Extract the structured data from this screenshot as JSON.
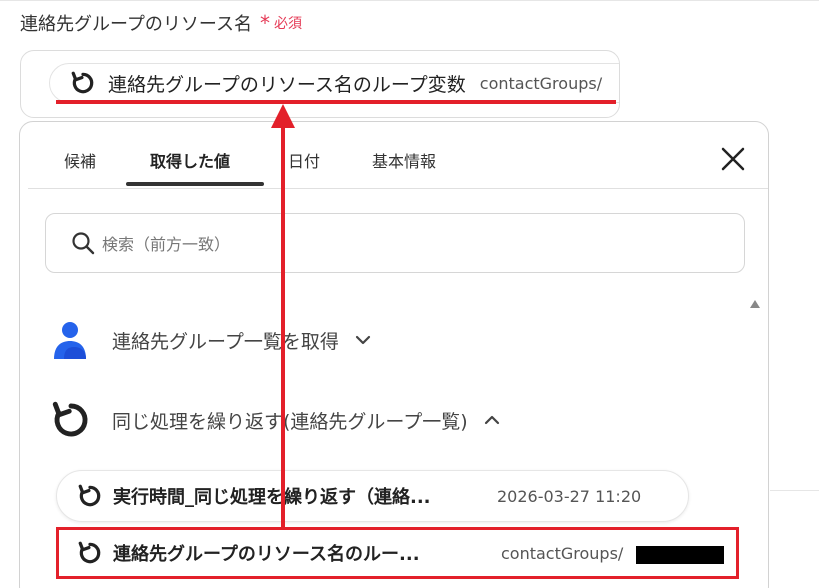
{
  "field": {
    "label": "連絡先グループのリソース名",
    "asterisk": "*",
    "required": "必須",
    "chip_title": "連絡先グループのリソース名のループ変数",
    "chip_sub": "contactGroups/"
  },
  "panel": {
    "tabs": [
      {
        "label": "候補"
      },
      {
        "label": "取得した値"
      },
      {
        "label": "日付"
      },
      {
        "label": "基本情報"
      }
    ],
    "active_tab": "取得した値",
    "search_placeholder": "検索（前方一致）",
    "groups": [
      {
        "label": "連絡先グループ一覧を取得",
        "state": "collapsed",
        "icon": "person-icon"
      },
      {
        "label": "同じ処理を繰り返す(連絡先グループ一覧)",
        "state": "expanded",
        "icon": "loop-icon"
      }
    ],
    "items": [
      {
        "title": "実行時間_同じ処理を繰り返す（連絡...",
        "value": "2026-03-27 11:20"
      },
      {
        "title": "連絡先グループのリソース名のルー...",
        "value": "contactGroups/"
      }
    ]
  },
  "colors": {
    "accent_red": "#e3202a",
    "required_pink": "#e53955",
    "person_blue": "#2563eb"
  }
}
